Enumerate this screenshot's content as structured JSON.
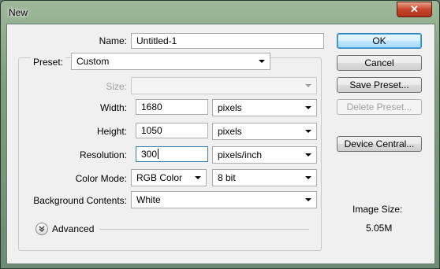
{
  "window": {
    "title": "New",
    "close_label": "✕"
  },
  "form": {
    "name_label": "Name:",
    "name_value": "Untitled-1",
    "preset_label": "Preset:",
    "preset_value": "Custom",
    "size_label": "Size:",
    "size_value": "",
    "width_label": "Width:",
    "width_value": "1680",
    "width_unit": "pixels",
    "height_label": "Height:",
    "height_value": "1050",
    "height_unit": "pixels",
    "resolution_label": "Resolution:",
    "resolution_value": "300",
    "resolution_unit": "pixels/inch",
    "color_mode_label": "Color Mode:",
    "color_mode_value": "RGB Color",
    "bit_depth_value": "8 bit",
    "background_label": "Background Contents:",
    "background_value": "White",
    "advanced_label": "Advanced"
  },
  "buttons": {
    "ok": "OK",
    "cancel": "Cancel",
    "save_preset": "Save Preset...",
    "delete_preset": "Delete Preset...",
    "device_central": "Device Central..."
  },
  "info": {
    "image_size_label": "Image Size:",
    "image_size_value": "5.05M"
  }
}
